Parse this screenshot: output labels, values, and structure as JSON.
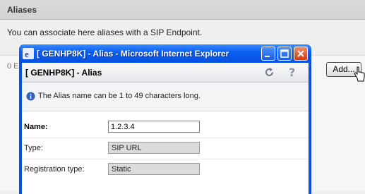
{
  "background": {
    "section_title": "Aliases",
    "description": "You can associate here aliases with a SIP Endpoint.",
    "count_text": "0 E",
    "add_button_label": "Add..."
  },
  "window": {
    "title": "[ GENHP8K] - Alias - Microsoft Internet Explorer"
  },
  "dialog": {
    "title": "[ GENHP8K] - Alias",
    "info_text": "The Alias name can be 1 to 49 characters long.",
    "fields": {
      "name_label": "Name:",
      "name_value": "1.2.3.4",
      "type_label": "Type:",
      "type_value": "SIP URL",
      "registration_label": "Registration type:",
      "registration_value": "Static"
    }
  },
  "colors": {
    "titlebar": "#0b5ff0",
    "close_button": "#d23b10",
    "readonly_field": "#dcdcdc"
  }
}
